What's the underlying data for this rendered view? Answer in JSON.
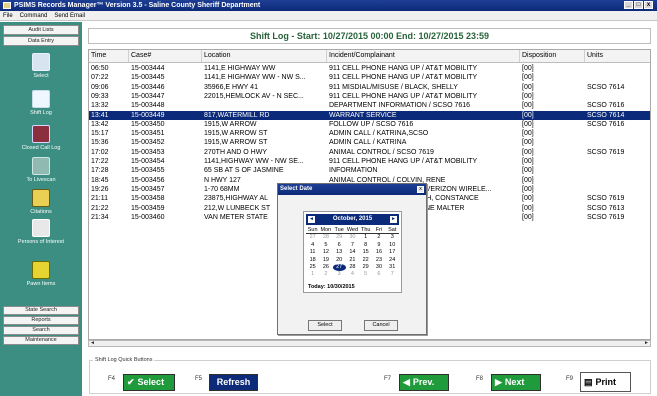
{
  "window": {
    "title": "PSIMS Records Manager™ Version 3.5 - Saline County Sheriff Department",
    "menu": [
      "File",
      "Command",
      "Send Email"
    ]
  },
  "sidebar": {
    "tabs": [
      "Audit Lists",
      "Data Entry"
    ],
    "items": [
      {
        "label": "Select",
        "icon": "select-icon"
      },
      {
        "label": "Shift Log",
        "icon": "notebook-icon"
      },
      {
        "label": "Closed Call Log",
        "icon": "closed-call-icon"
      },
      {
        "label": "To Livescan",
        "icon": "livescan-icon"
      },
      {
        "label": "Citations",
        "icon": "citations-icon"
      },
      {
        "label": "Persons of Interest",
        "icon": "persons-icon"
      },
      {
        "label": "Pawn Items",
        "icon": "pawn-icon"
      }
    ],
    "bottom": [
      "State Search",
      "Reports",
      "Search",
      "Maintenance"
    ]
  },
  "shiftlog": {
    "header": "Shift Log - Start: 10/27/2015 00:00  End: 10/27/2015 23:59",
    "columns": [
      "Time",
      "Case#",
      "Location",
      "Incident/Complainant",
      "Disposition",
      "Units"
    ],
    "rows": [
      {
        "time": "06:50",
        "case": "15-003444",
        "loc": "1141,E HIGHWAY WW",
        "inc": "911 CELL PHONE HANG UP / AT&T MOBILITY",
        "dis": "[00]",
        "unit": ""
      },
      {
        "time": "07:22",
        "case": "15-003445",
        "loc": "1141,E HIGHWAY WW - NW S...",
        "inc": "911 CELL PHONE HANG UP / AT&T MOBILITY",
        "dis": "[00]",
        "unit": ""
      },
      {
        "time": "09:06",
        "case": "15-003446",
        "loc": "35966,E HWY 41",
        "inc": "911 MISDIAL/MISUSE / BLACK, SHELLY",
        "dis": "[00]",
        "unit": "SCSO 7614"
      },
      {
        "time": "09:33",
        "case": "15-003447",
        "loc": "22015,HEMLOCK AV - N SEC...",
        "inc": "911 CELL PHONE HANG UP / AT&T MOBILITY",
        "dis": "[00]",
        "unit": ""
      },
      {
        "time": "13:32",
        "case": "15-003448",
        "loc": "",
        "inc": "DEPARTMENT INFORMATION / SCSO 7616",
        "dis": "[00]",
        "unit": "SCSO 7616"
      },
      {
        "time": "13:41",
        "case": "15-003449",
        "loc": "817,WATERMILL RD",
        "inc": "WARRANT SERVICE",
        "dis": "[00]",
        "unit": "SCSO 7614"
      },
      {
        "time": "13:42",
        "case": "15-003450",
        "loc": "1915,W ARROW",
        "inc": "FOLLOW UP / SCSO 7616",
        "dis": "[00]",
        "unit": "SCSO 7616"
      },
      {
        "time": "15:17",
        "case": "15-003451",
        "loc": "1915,W ARROW ST",
        "inc": "ADMIN CALL / KATRINA,SCSO",
        "dis": "[00]",
        "unit": ""
      },
      {
        "time": "15:36",
        "case": "15-003452",
        "loc": "1915,W ARROW ST",
        "inc": "ADMIN CALL / KATRINA",
        "dis": "[00]",
        "unit": ""
      },
      {
        "time": "17:02",
        "case": "15-003453",
        "loc": "270TH AND O HWY",
        "inc": "ANIMAL CONTROL / SCSO 7619",
        "dis": "[00]",
        "unit": "SCSO 7619"
      },
      {
        "time": "17:22",
        "case": "15-003454",
        "loc": "1141,HIGHWAY WW - NW SE...",
        "inc": "911 CELL PHONE HANG UP / AT&T MOBILITY",
        "dis": "[00]",
        "unit": ""
      },
      {
        "time": "17:28",
        "case": "15-003455",
        "loc": "65 SB AT S OF JASMINE",
        "inc": "INFORMATION",
        "dis": "[00]",
        "unit": ""
      },
      {
        "time": "18:45",
        "case": "15-003456",
        "loc": "N HWY 127",
        "inc": "ANIMAL CONTROL / COLVIN, RENE",
        "dis": "[00]",
        "unit": ""
      },
      {
        "time": "19:26",
        "case": "15-003457",
        "loc": "1-70 68MM",
        "inc": "911 CELL PHONE HANG UP / VERIZON WIRELE...",
        "dis": "[00]",
        "unit": ""
      },
      {
        "time": "21:11",
        "case": "15-003458",
        "loc": "23875,HIGHWAY AL",
        "inc": "SUSPICIOUS PERSON / SMITH, CONSTANCE",
        "dis": "[00]",
        "unit": "SCSO 7619"
      },
      {
        "time": "21:22",
        "case": "15-003459",
        "loc": "212,W LUNBECK ST",
        "inc": "DISTURBANCE / MALTER, JANE MALTER",
        "dis": "[00]",
        "unit": "SCSO 7613"
      },
      {
        "time": "21:34",
        "case": "15-003460",
        "loc": "VAN METER STATE",
        "inc": "INFORMATION / SCSO 7619",
        "dis": "[00]",
        "unit": "SCSO 7619"
      }
    ]
  },
  "quickbuttons": {
    "legend": "Shift Log Quick Buttons",
    "select": {
      "key": "F4",
      "label": "Select"
    },
    "refresh": {
      "key": "F5",
      "label": "Refresh"
    },
    "prev": {
      "key": "F7",
      "label": "Prev."
    },
    "next": {
      "key": "F8",
      "label": "Next"
    },
    "print": {
      "key": "F9",
      "label": "Print"
    }
  },
  "dialog": {
    "title": "Select Date",
    "month": "October, 2015",
    "weekdays": [
      "Sun",
      "Mon",
      "Tue",
      "Wed",
      "Thu",
      "Fri",
      "Sat"
    ],
    "weeks": [
      [
        "27",
        "28",
        "29",
        "30",
        "1",
        "2",
        "3"
      ],
      [
        "4",
        "5",
        "6",
        "7",
        "8",
        "9",
        "10"
      ],
      [
        "11",
        "12",
        "13",
        "14",
        "15",
        "16",
        "17"
      ],
      [
        "18",
        "19",
        "20",
        "21",
        "22",
        "23",
        "24"
      ],
      [
        "25",
        "26",
        "27",
        "28",
        "29",
        "30",
        "31"
      ],
      [
        "1",
        "2",
        "3",
        "4",
        "5",
        "6",
        "7"
      ]
    ],
    "today": "Today: 10/30/2015",
    "select": "Select",
    "cancel": "Cancel"
  },
  "colors": {
    "sidebar": "#3b8e81",
    "selection": "#0b2a7a",
    "header_text": "#27623a",
    "button_green": "#1f9b3b"
  }
}
